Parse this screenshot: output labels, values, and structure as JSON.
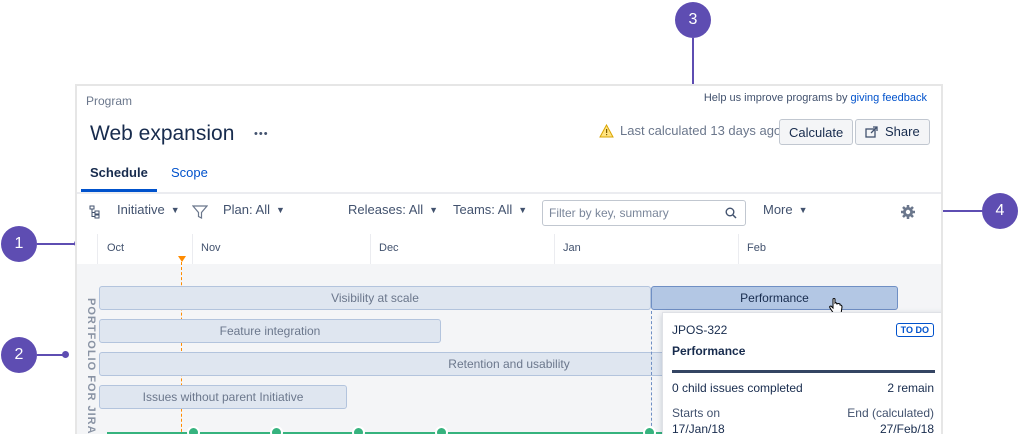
{
  "breadcrumb": "Program",
  "help": {
    "prefix": "Help us improve programs by ",
    "link": "giving feedback"
  },
  "page_title": "Web expansion",
  "more_dots": "•••",
  "last_calculated": "Last calculated 13 days ago",
  "buttons": {
    "calculate": "Calculate",
    "share": "Share"
  },
  "tabs": {
    "schedule": "Schedule",
    "scope": "Scope"
  },
  "toolbar": {
    "initiative": "Initiative",
    "plan": "Plan: All",
    "releases": "Releases: All",
    "teams": "Teams: All",
    "filter_placeholder": "Filter by key, summary",
    "more": "More"
  },
  "months": [
    "Oct",
    "Nov",
    "Dec",
    "Jan",
    "Feb"
  ],
  "side_label": "PORTFOLIO FOR JIRA",
  "bars": [
    {
      "label": "Visibility at scale"
    },
    {
      "label": "Performance"
    },
    {
      "label": "Feature integration"
    },
    {
      "label": "Retention and usability"
    },
    {
      "label": "Issues without parent Initiative"
    }
  ],
  "card": {
    "key": "JPOS-322",
    "status": "TO DO",
    "title": "Performance",
    "completed": "0 child issues completed",
    "remain": "2 remain",
    "start_label": "Starts on",
    "end_label": "End (calculated)",
    "start_value": "17/Jan/18",
    "end_value": "27/Feb/18"
  },
  "callouts": [
    "1",
    "2",
    "3",
    "4"
  ],
  "colors": {
    "accent": "#0052cc",
    "callout": "#5e4db2",
    "bar": "#dfe6f0",
    "selected_bar": "#b3c7e4"
  }
}
